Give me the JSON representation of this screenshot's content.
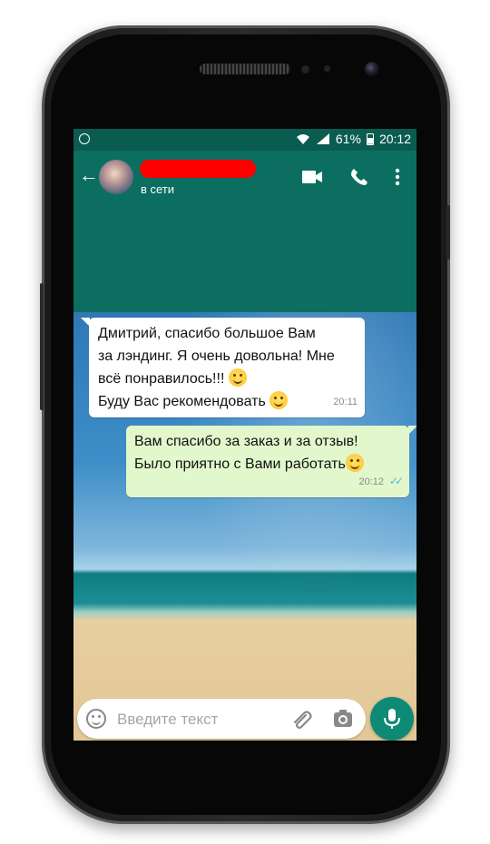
{
  "status_bar": {
    "battery": "61%",
    "time": "20:12"
  },
  "app_bar": {
    "contact_status": "в сети"
  },
  "messages": [
    {
      "direction": "incoming",
      "lines": [
        "Дмитрий,  спасибо большое Вам",
        "за лэндинг. Я очень довольна! Мне",
        "всё понравилось!!!",
        "Буду Вас рекомендовать"
      ],
      "time": "20:11"
    },
    {
      "direction": "outgoing",
      "lines": [
        "Вам спасибо за заказ и за отзыв!",
        "Было приятно с Вами работать"
      ],
      "time": "20:12"
    }
  ],
  "composer": {
    "placeholder": "Введите текст"
  },
  "colors": {
    "header": "#0b6e60",
    "outgoing_bubble": "#e2f7cb",
    "mic_button": "#0e8a76",
    "redaction": "#ff0000"
  },
  "icons": [
    "back-arrow-icon",
    "video-call-icon",
    "phone-icon",
    "more-vert-icon",
    "emoji-icon",
    "attach-icon",
    "camera-icon",
    "mic-icon",
    "double-check-icon"
  ]
}
